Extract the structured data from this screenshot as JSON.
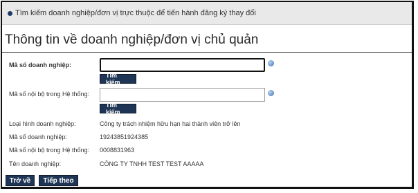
{
  "header": {
    "breadcrumb": "Tìm kiếm doanh nghiệp/đơn vị trực thuộc để tiến hành đăng ký thay đổi"
  },
  "section": {
    "title": "Thông tin về doanh nghiệp/đơn vị chủ quản"
  },
  "search": {
    "enterprise_code_label": "Mã số doanh nghiệp:",
    "enterprise_code_value": "",
    "internal_code_label": "Mã số nội bộ trong Hệ thống:",
    "internal_code_value": "",
    "search_button_label": "Tìm kiếm"
  },
  "details": {
    "type_label": "Loại hình doanh nghiệp:",
    "type_value": "Công ty trách nhiệm hữu hạn hai thành viên trở lên",
    "code_label": "Mã số doanh nghiệp:",
    "code_value": "19243851924385",
    "internal_label": "Mã số nội bộ trong Hệ thống:",
    "internal_value": "0008831963",
    "name_label": "Tên doanh nghiệp:",
    "name_value": "CÔNG TY TNHH TEST TEST AAAAA"
  },
  "actions": {
    "back_label": "Trở về",
    "next_label": "Tiếp theo"
  }
}
